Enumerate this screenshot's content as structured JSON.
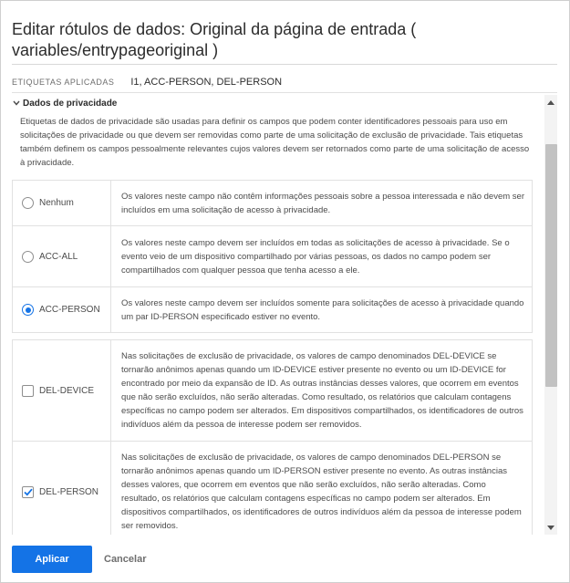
{
  "dialog": {
    "title": "Editar rótulos de dados: Original da página de entrada ( variables/entrypageoriginal )"
  },
  "applied": {
    "label": "ETIQUETAS APLICADAS",
    "value": "I1, ACC-PERSON, DEL-PERSON"
  },
  "section": {
    "title": "Dados de privacidade",
    "description": "Etiquetas de dados de privacidade são usadas para definir os campos que podem conter identificadores pessoais para uso em solicitações de privacidade ou que devem ser removidas como parte de uma solicitação de exclusão de privacidade. Tais etiquetas também definem os campos pessoalmente relevantes cujos valores devem ser retornados como parte de uma solicitação de acesso à privacidade."
  },
  "options": [
    {
      "label": "Nenhum",
      "control": "radio",
      "checked": false,
      "description": "Os valores neste campo não contêm informações pessoais sobre a pessoa interessada e não devem ser incluídos em uma solicitação de acesso à privacidade."
    },
    {
      "label": "ACC-ALL",
      "control": "radio",
      "checked": false,
      "description": "Os valores neste campo devem ser incluídos em todas as solicitações de acesso à privacidade. Se o evento veio de um dispositivo compartilhado por várias pessoas, os dados no campo podem ser compartilhados com qualquer pessoa que tenha acesso a ele."
    },
    {
      "label": "ACC-PERSON",
      "control": "radio",
      "checked": true,
      "description": "Os valores neste campo devem ser incluídos somente para solicitações de acesso à privacidade quando um par ID-PERSON especificado estiver no evento."
    },
    {
      "label": "DEL-DEVICE",
      "control": "checkbox",
      "checked": false,
      "description": "Nas solicitações de exclusão de privacidade, os valores de campo denominados DEL-DEVICE se tornarão anônimos apenas quando um ID-DEVICE estiver presente no evento ou um ID-DEVICE for encontrado por meio da expansão de ID. As outras instâncias desses valores, que ocorrem em eventos que não serão excluídos, não serão alteradas. Como resultado, os relatórios que calculam contagens específicas no campo podem ser alterados. Em dispositivos compartilhados, os identificadores de outros indivíduos além da pessoa de interesse podem ser removidos."
    },
    {
      "label": "DEL-PERSON",
      "control": "checkbox",
      "checked": true,
      "description": "Nas solicitações de exclusão de privacidade, os valores de campo denominados DEL-PERSON se tornarão anônimos apenas quando um ID-PERSON estiver presente no evento. As outras instâncias desses valores, que ocorrem em eventos que não serão excluídos, não serão alteradas. Como resultado, os relatórios que calculam contagens específicas no campo podem ser alterados. Em dispositivos compartilhados, os identificadores de outros indivíduos além da pessoa de interesse podem ser removidos."
    }
  ],
  "footer": {
    "apply_label": "Aplicar",
    "cancel_label": "Cancelar"
  },
  "colors": {
    "accent": "#1473e6",
    "border": "#e1e1e1",
    "text": "#4b4b4b"
  },
  "icons": {
    "section_toggle": "chevron-down-icon",
    "scroll_up": "triangle-up-icon",
    "scroll_down": "triangle-down-icon",
    "check": "checkmark-icon"
  }
}
